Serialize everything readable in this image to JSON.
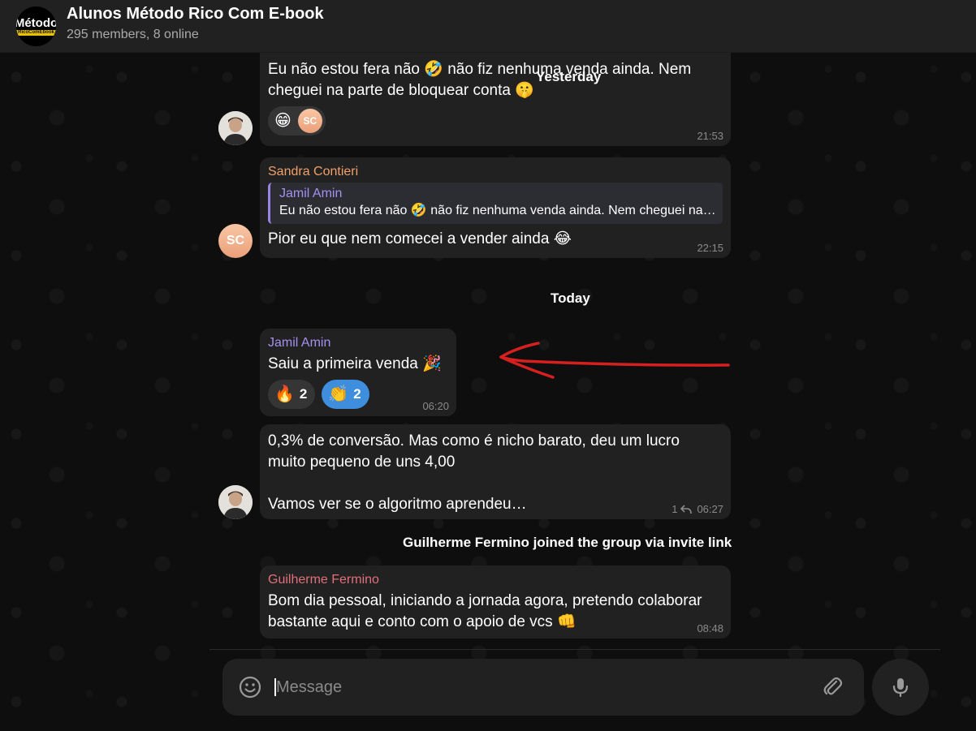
{
  "header": {
    "avatar_line1": "Método",
    "avatar_line2": "RicoComEbook",
    "title": "Alunos Método Rico Com E-book",
    "subtitle": "295 members, 8 online"
  },
  "dates": {
    "yesterday": "Yesterday",
    "today": "Today"
  },
  "messages": [
    {
      "text_line1": "Eu não estou fera não 🤣 não fiz nenhuma venda ainda. Nem",
      "text_line2": "cheguei na parte de bloquear conta 🤫",
      "time": "21:53",
      "reactions": [
        {
          "emoji": "😁"
        },
        {
          "initials": "SC"
        }
      ]
    },
    {
      "sender": "Sandra Contieri",
      "sender_color": "#f0a06a",
      "reply_to": {
        "name": "Jamil Amin",
        "text": "Eu não estou fera não 🤣 não fiz nenhuma venda ainda. Nem cheguei na parte de bloquear conta 🤫"
      },
      "text": "Pior eu que nem comecei a vender ainda 😂",
      "time": "22:15",
      "avatar_initials": "SC"
    },
    {
      "sender": "Jamil Amin",
      "sender_color": "#a58ff0",
      "text": "Saiu a primeira venda 🎉",
      "time": "06:20",
      "reactions": [
        {
          "emoji": "🔥",
          "count": "2"
        },
        {
          "emoji": "👏",
          "count": "2"
        }
      ]
    },
    {
      "text_line1": "0,3% de conversão. Mas como é nicho barato, deu um lucro",
      "text_line2": "muito pequeno de uns 4,00",
      "text_line3": "Vamos ver se o algoritmo aprendeu…",
      "replies": "1",
      "time": "06:27"
    },
    {
      "sender": "Guilherme Fermino",
      "sender_color": "#e0707a",
      "text_line1": "Bom dia pessoal, iniciando a jornada agora, pretendo colaborar",
      "text_line2": "bastante aqui e conto com o apoio de vcs 👊",
      "time": "08:48"
    }
  ],
  "service_message": "Guilherme Fermino joined the group via invite link",
  "composer": {
    "placeholder": "Message"
  },
  "colors": {
    "bubble": "#212121",
    "accent": "#3e8edd",
    "annotation_arrow": "#d62020"
  }
}
